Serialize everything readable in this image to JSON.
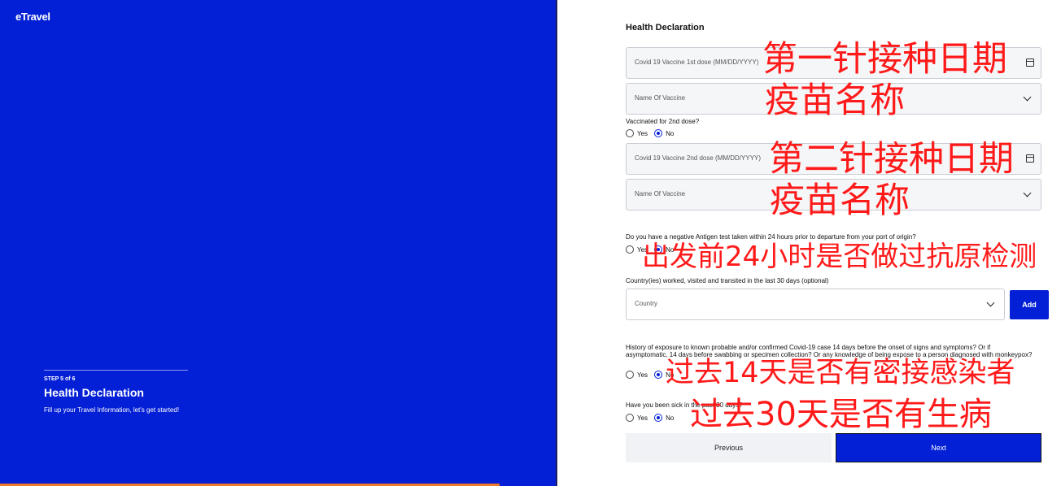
{
  "left": {
    "logo": "eTravel",
    "step": "STEP 5 of 6",
    "title": "Health Declaration",
    "subtitle": "Fill up your Travel Information, let's get started!"
  },
  "form": {
    "title": "Health Declaration",
    "dose1_placeholder": "Covid 19 Vaccine 1st dose (MM/DD/YYYY)",
    "vaccine_placeholder": "Name Of Vaccine",
    "dose2_question": "Vaccinated for 2nd dose?",
    "dose2_placeholder": "Covid 19 Vaccine 2nd dose (MM/DD/YYYY)",
    "antigen_question": "Do you have a negative Antigen test taken within 24 hours prior to departure from your port of origin?",
    "country_question": "Country(ies) worked, visited and transited in the last 30 days (optional)",
    "country_placeholder": "Country",
    "add_label": "Add",
    "exposure_question": "History of exposure to known probable and/or confirmed Covid-19 case 14 days before the onset of signs and symptoms? Or if asymptomatic, 14 days before swabbing or specimen collection? Or any knowledge of being expose to a person diagnosed with monkeypox?",
    "sick_question": "Have you been sick in the past 30 days?",
    "yes": "Yes",
    "no": "No",
    "previous_label": "Previous",
    "next_label": "Next"
  },
  "annotations": {
    "a1": "第一针接种日期",
    "a2": "疫苗名称",
    "a3": "第二针接种日期",
    "a4": "疫苗名称",
    "a5": "出发前24小时是否做过抗原检测",
    "a6": "过去14天是否有密接感染者",
    "a7": "过去30天是否有生病"
  },
  "colors": {
    "brand_blue": "#0420d6",
    "annotation_red": "#ff1a1a",
    "progress_orange": "#f07a2a"
  }
}
